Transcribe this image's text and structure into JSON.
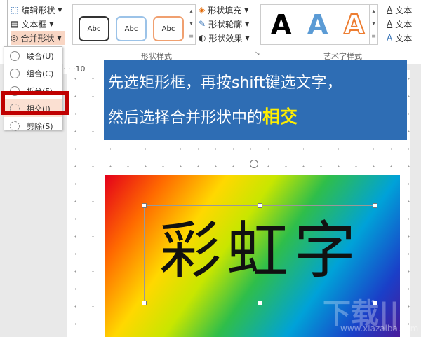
{
  "ribbon": {
    "left_items": [
      "编辑形状",
      "文本框",
      "合并形状"
    ],
    "shape_style_samples": [
      "Abc",
      "Abc",
      "Abc"
    ],
    "shape_cmds": [
      "形状填充",
      "形状轮廓",
      "形状效果"
    ],
    "shape_group_label": "形状样式",
    "wordart_samples": [
      "A",
      "A",
      "A"
    ],
    "text_cmds": [
      "文本",
      "文本",
      "文本"
    ],
    "wordart_group_label": "艺术字样式"
  },
  "ruler": {
    "mark": "10"
  },
  "merge_menu": {
    "items": [
      "联合(U)",
      "组合(C)",
      "拆分(F)",
      "相交(I)",
      "剪除(S)"
    ],
    "highlighted": "相交(I)"
  },
  "callout": {
    "line1": "先选矩形框，再按shift键选文字，",
    "line2_prefix": "然后选择合并形状中的",
    "line2_highlight": "相交"
  },
  "slide": {
    "art_text": "彩虹字"
  },
  "watermark": {
    "logo": "下载吧",
    "url": "www.xiazaiba.com"
  },
  "colors": {
    "callout_bg": "#2e6db4",
    "highlight": "#ffee00",
    "red_box": "#c00000"
  }
}
